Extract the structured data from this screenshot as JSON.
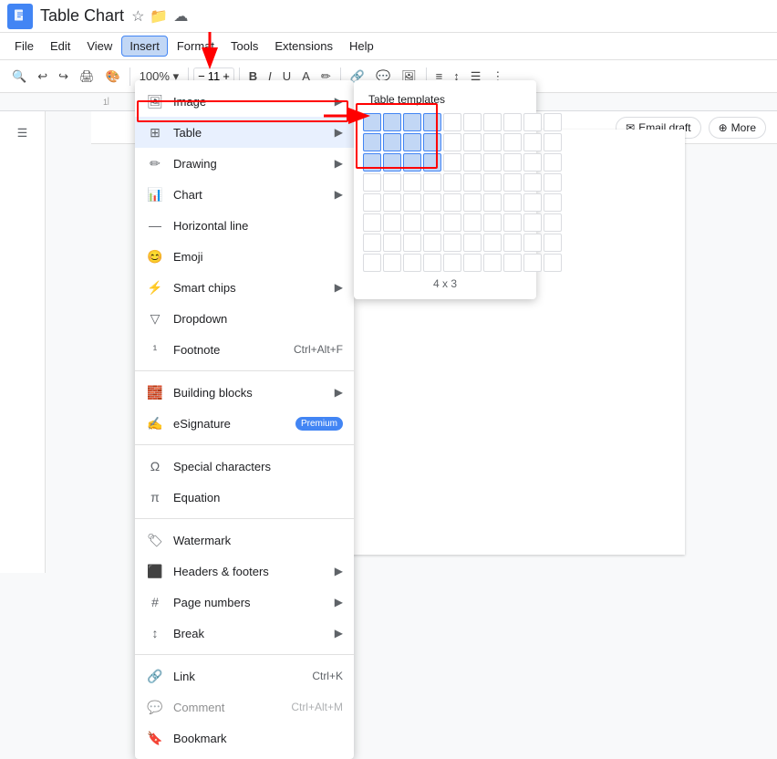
{
  "title": "Table Chart",
  "menu": {
    "items": [
      "File",
      "Edit",
      "View",
      "Insert",
      "Format",
      "Tools",
      "Extensions",
      "Help"
    ]
  },
  "toolbar": {
    "font_size": "11",
    "buttons": [
      "search",
      "undo",
      "redo",
      "print",
      "paint-format",
      "font-family",
      "font-size",
      "bold",
      "italic",
      "underline",
      "font-color",
      "highlight",
      "link",
      "comment",
      "image",
      "align",
      "line-spacing",
      "list",
      "more"
    ]
  },
  "dropdown": {
    "title": "Insert menu",
    "items": [
      {
        "id": "image",
        "label": "Image",
        "has_arrow": true,
        "icon": "image"
      },
      {
        "id": "table",
        "label": "Table",
        "has_arrow": true,
        "icon": "table",
        "highlighted": true
      },
      {
        "id": "drawing",
        "label": "Drawing",
        "has_arrow": true,
        "icon": "drawing"
      },
      {
        "id": "chart",
        "label": "Chart",
        "has_arrow": true,
        "icon": "chart"
      },
      {
        "id": "horizontal-line",
        "label": "Horizontal line",
        "has_arrow": false,
        "icon": "hr"
      },
      {
        "id": "emoji",
        "label": "Emoji",
        "has_arrow": false,
        "icon": "emoji"
      },
      {
        "id": "smart-chips",
        "label": "Smart chips",
        "has_arrow": true,
        "icon": "smart-chips"
      },
      {
        "id": "dropdown",
        "label": "Dropdown",
        "has_arrow": false,
        "icon": "dropdown"
      },
      {
        "id": "footnote",
        "label": "Footnote",
        "has_arrow": false,
        "icon": "footnote",
        "shortcut": "Ctrl+Alt+F"
      },
      {
        "id": "building-blocks",
        "label": "Building blocks",
        "has_arrow": true,
        "icon": "building"
      },
      {
        "id": "esignature",
        "label": "eSignature",
        "has_arrow": false,
        "icon": "esig",
        "badge": "Premium"
      },
      {
        "id": "special-chars",
        "label": "Special characters",
        "has_arrow": false,
        "icon": "omega"
      },
      {
        "id": "equation",
        "label": "Equation",
        "has_arrow": false,
        "icon": "pi"
      },
      {
        "id": "watermark",
        "label": "Watermark",
        "has_arrow": false,
        "icon": "watermark"
      },
      {
        "id": "headers-footers",
        "label": "Headers & footers",
        "has_arrow": true,
        "icon": "headers"
      },
      {
        "id": "page-numbers",
        "label": "Page numbers",
        "has_arrow": true,
        "icon": "page-numbers"
      },
      {
        "id": "break",
        "label": "Break",
        "has_arrow": true,
        "icon": "break"
      },
      {
        "id": "link",
        "label": "Link",
        "has_arrow": false,
        "icon": "link",
        "shortcut": "Ctrl+K"
      },
      {
        "id": "comment",
        "label": "Comment",
        "has_arrow": false,
        "icon": "comment",
        "shortcut": "Ctrl+Alt+M",
        "disabled": true
      },
      {
        "id": "bookmark",
        "label": "Bookmark",
        "has_arrow": false,
        "icon": "bookmark"
      }
    ]
  },
  "table_submenu": {
    "title": "Table templates",
    "size_label": "4 x 3",
    "grid_cols": 10,
    "grid_rows": 8,
    "selected_cols": 4,
    "selected_rows": 3
  },
  "chips": [
    {
      "label": "Email draft",
      "icon": "email"
    },
    {
      "label": "More",
      "icon": "omega"
    }
  ],
  "document_title": "Table Chart"
}
